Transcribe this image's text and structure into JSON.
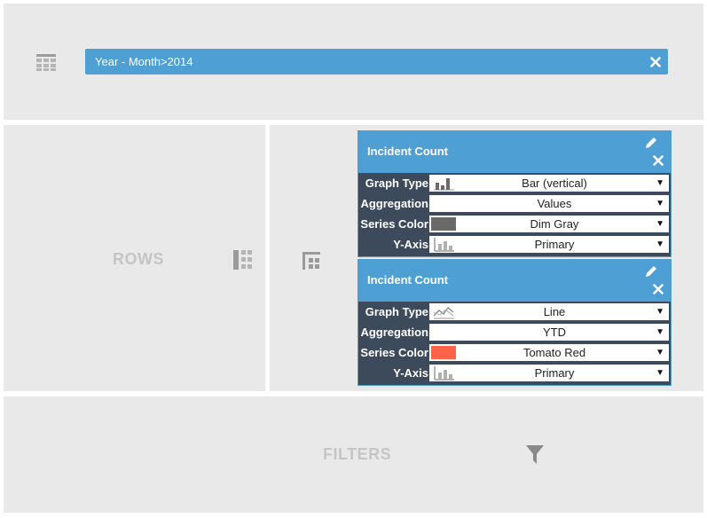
{
  "columns": {
    "icon": "table-columns-icon",
    "field_pill": {
      "label": "Year - Month>2014",
      "remove_icon": "close-icon"
    }
  },
  "rows": {
    "label": "ROWS",
    "icon": "rows-icon"
  },
  "values": {
    "icon": "values-grid-icon",
    "series": [
      {
        "title": "Incident Count",
        "edit_icon": "pencil-icon",
        "remove_icon": "close-icon",
        "properties": {
          "graph_type": {
            "label": "Graph Type",
            "value": "Bar (vertical)",
            "icon": "bar-chart-icon"
          },
          "aggregation": {
            "label": "Aggregation",
            "value": "Values"
          },
          "series_color": {
            "label": "Series Color",
            "value": "Dim Gray",
            "swatch": "#696969"
          },
          "y_axis": {
            "label": "Y-Axis",
            "value": "Primary",
            "icon": "axis-icon"
          }
        }
      },
      {
        "title": "Incident Count",
        "edit_icon": "pencil-icon",
        "remove_icon": "close-icon",
        "properties": {
          "graph_type": {
            "label": "Graph Type",
            "value": "Line",
            "icon": "line-chart-icon"
          },
          "aggregation": {
            "label": "Aggregation",
            "value": "YTD"
          },
          "series_color": {
            "label": "Series Color",
            "value": "Tomato Red",
            "swatch": "#ff6347"
          },
          "y_axis": {
            "label": "Y-Axis",
            "value": "Primary",
            "icon": "axis-icon"
          }
        }
      }
    ]
  },
  "filters": {
    "label": "FILTERS",
    "icon": "funnel-icon"
  },
  "colors": {
    "panel_bg": "#e9e9e9",
    "accent": "#4d9fd4",
    "card_bg": "#3d4a5c",
    "placeholder_text": "#c5c5c5"
  }
}
